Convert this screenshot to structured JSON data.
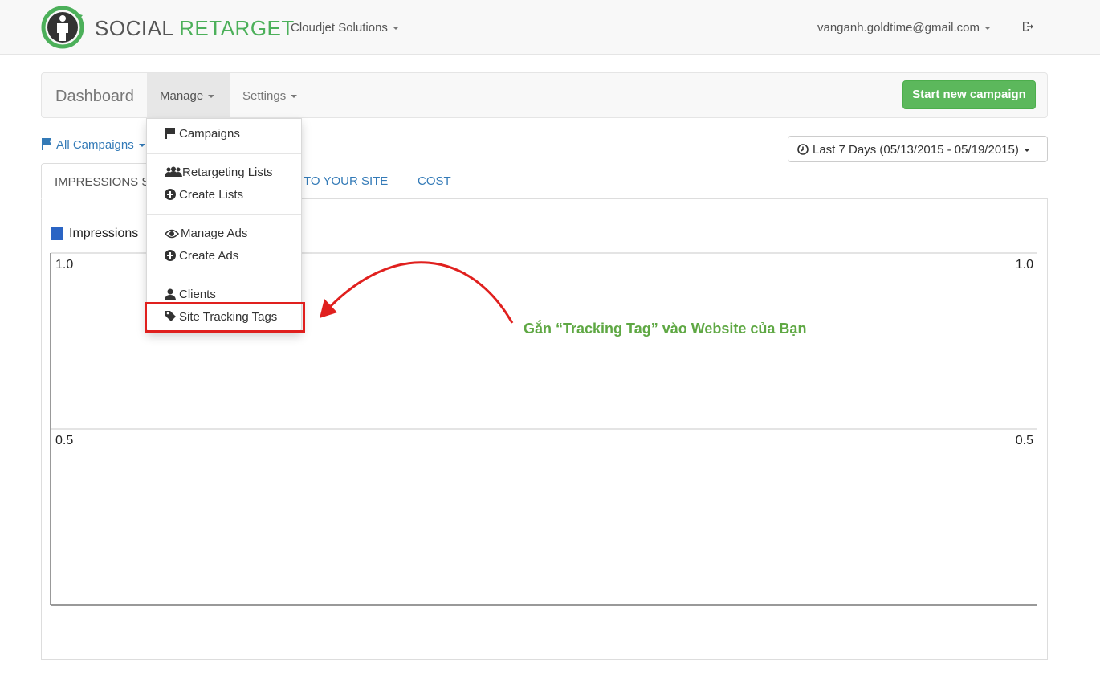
{
  "header": {
    "logo_text_1": "SOCIAL",
    "logo_text_2": "RETARGET",
    "organization": "Cloudjet Solutions",
    "user_email": "vanganh.goldtime@gmail.com",
    "logout_icon": "sign-out-icon"
  },
  "navbar": {
    "brand": "Dashboard",
    "manage": "Manage",
    "settings": "Settings",
    "new_campaign": "Start new campaign"
  },
  "filters": {
    "campaigns": "All Campaigns",
    "date_range": "Last 7 Days (05/13/2015 - 05/19/2015)"
  },
  "tabs": {
    "impressions": "IMPRESSIONS S",
    "site": "TO YOUR SITE",
    "cost": "COST"
  },
  "manage_menu": {
    "campaigns": "Campaigns",
    "retargeting_lists": "Retargeting Lists",
    "create_lists": "Create Lists",
    "manage_ads": "Manage Ads",
    "create_ads": "Create Ads",
    "clients": "Clients",
    "site_tracking_tags": "Site Tracking Tags"
  },
  "annotation": {
    "text": "Gắn “Tracking Tag” vào Website của Bạn",
    "color": "#5fa844",
    "arrow_color": "#e0201e"
  },
  "colors": {
    "brand_green": "#4cb05a",
    "button_green": "#5cb85c",
    "link_blue": "#337ab7",
    "series_blue": "#2a64c4"
  },
  "chart_data": {
    "type": "line",
    "title": "",
    "series": [
      {
        "name": "Impressions",
        "values": []
      }
    ],
    "y_ticks_left": [
      "1.0",
      "0.5"
    ],
    "y_ticks_right": [
      "1.0",
      "0.5"
    ],
    "ylim": [
      0,
      1.0
    ],
    "grid": true,
    "legend": "top-left"
  }
}
